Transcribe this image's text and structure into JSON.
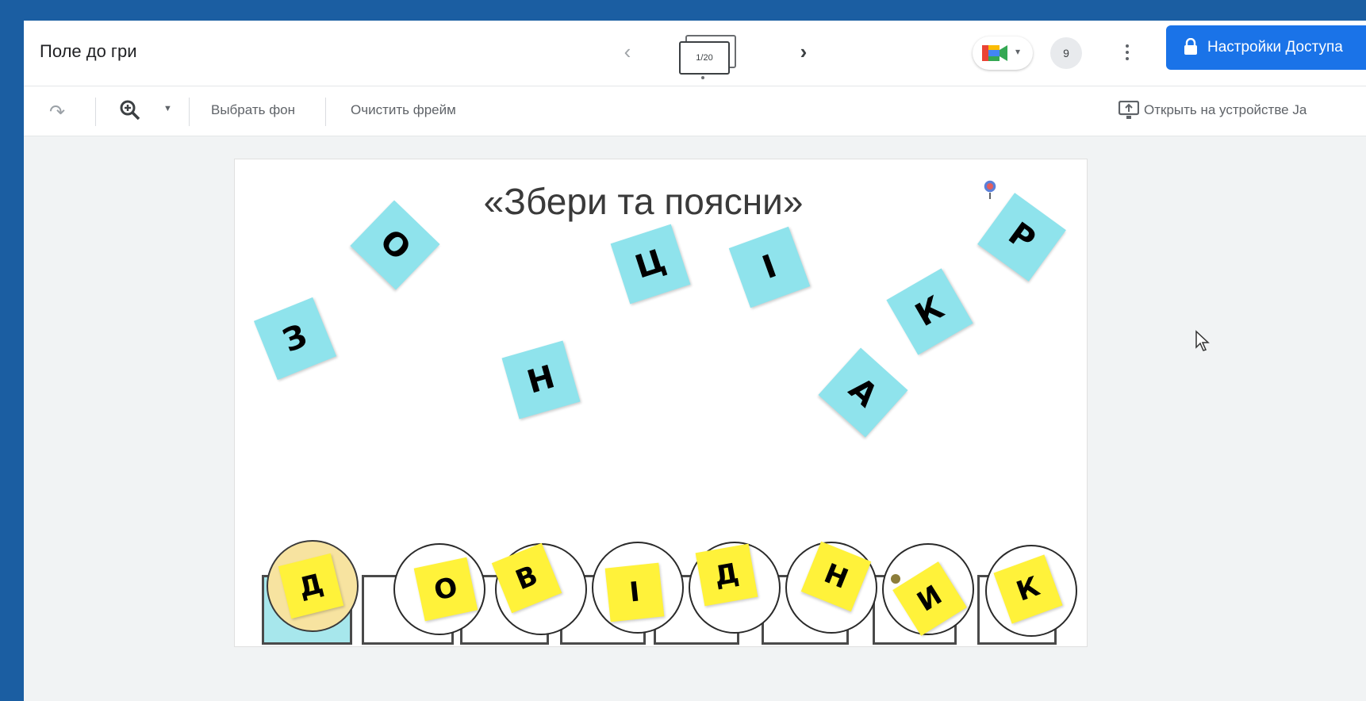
{
  "topbar": {
    "title": "Поле до гри",
    "frame_counter": "1/20",
    "participant_count": "9",
    "share_label": "Настройки Доступа"
  },
  "toolbar": {
    "choose_background": "Выбрать фон",
    "clear_frame": "Очистить фрейм",
    "open_on_device": "Открыть на устройстве Ja"
  },
  "board": {
    "title": "«Збери та поясни»",
    "scattered_cards": [
      "З",
      "О",
      "Ц",
      "І",
      "Р",
      "К",
      "Н",
      "А"
    ],
    "answer_notes": [
      "Д",
      "О",
      "В",
      "І",
      "Д",
      "Н",
      "И",
      "К"
    ]
  },
  "colors": {
    "desktop_bg": "#1b5ea2",
    "card_blue": "#8fe3ec",
    "note_yellow": "#fff23a",
    "share_button": "#1a73e8"
  },
  "icons": [
    "meet-icon",
    "lock-icon",
    "zoom-icon",
    "redo-icon",
    "cast-icon",
    "pin-icon",
    "cursor-icon"
  ]
}
